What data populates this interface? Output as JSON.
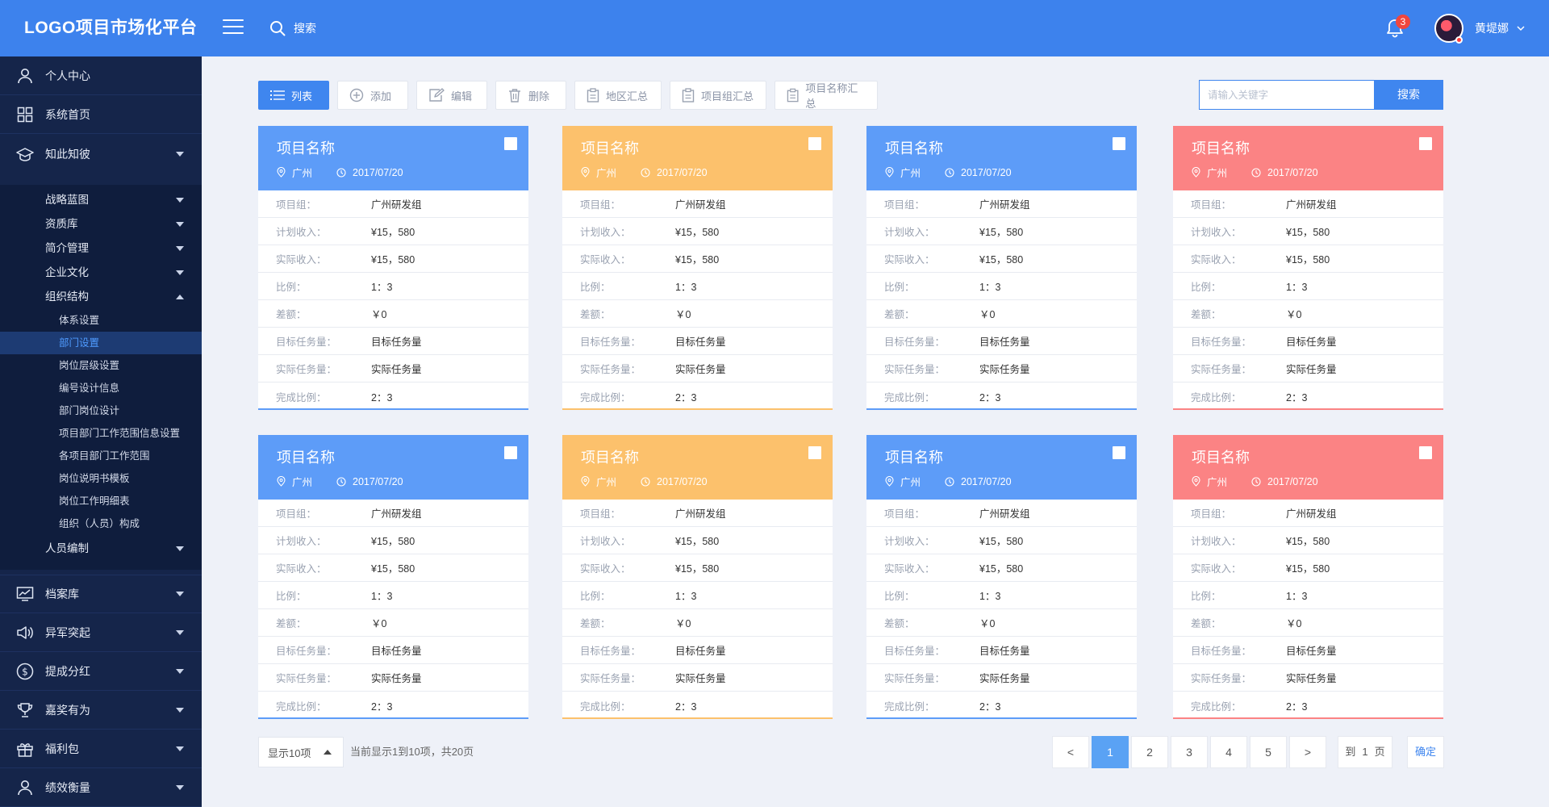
{
  "header": {
    "logo": "LOGO项目市场化平台",
    "search_label": "搜索",
    "notification_count": "3",
    "username": "黄堤娜",
    "bg_color": "#3d82ed"
  },
  "sidebar": {
    "top_items": [
      {
        "label": "个人中心",
        "icon": "user-icon"
      },
      {
        "label": "系统首页",
        "icon": "grid-icon"
      },
      {
        "label": "知此知彼",
        "icon": "graduation-cap-icon"
      }
    ],
    "sub_items": [
      "战略蓝图",
      "资质库",
      "简介管理",
      "企业文化",
      "组织结构"
    ],
    "sub3_items": [
      "体系设置",
      "部门设置",
      "岗位层级设置",
      "编号设计信息",
      "部门岗位设计",
      "项目部门工作范围信息设置",
      "各项目部门工作范围",
      "岗位说明书模板",
      "岗位工作明细表",
      "组织（人员）构成"
    ],
    "active_sub3": "部门设置",
    "extra_sub": "人员编制",
    "bottom_items": [
      {
        "label": "档案库",
        "icon": "chart-monitor-icon"
      },
      {
        "label": "异军突起",
        "icon": "speaker-icon"
      },
      {
        "label": "提成分红",
        "icon": "dollar-icon"
      },
      {
        "label": "嘉奖有为",
        "icon": "trophy-icon"
      },
      {
        "label": "福利包",
        "icon": "gift-icon"
      },
      {
        "label": "绩效衡量",
        "icon": "user-icon"
      }
    ]
  },
  "toolbar": {
    "buttons": [
      {
        "label": "列表",
        "icon": "list-icon"
      },
      {
        "label": "添加",
        "icon": "plus-circle-icon"
      },
      {
        "label": "编辑",
        "icon": "edit-icon"
      },
      {
        "label": "删除",
        "icon": "trash-icon"
      },
      {
        "label": "地区汇总",
        "icon": "clipboard-icon"
      },
      {
        "label": "项目组汇总",
        "icon": "clipboard-icon"
      },
      {
        "label": "项目名称汇总",
        "icon": "clipboard-icon"
      }
    ],
    "search_placeholder": "请输入关键字",
    "search_button": "搜索"
  },
  "cards": [
    {
      "title": "项目名称",
      "city": "广州",
      "date": "2017/07/20",
      "color": "#5d9cf8",
      "rows": [
        {
          "label": "项目组：",
          "value": "广州研发组"
        },
        {
          "label": "计划收入：",
          "value": "¥15，580"
        },
        {
          "label": "实际收入：",
          "value": "¥15，580"
        },
        {
          "label": "比例：",
          "value": "1：3"
        },
        {
          "label": "差额：",
          "value": "￥0"
        },
        {
          "label": "目标任务量：",
          "value": "目标任务量"
        },
        {
          "label": "实际任务量：",
          "value": "实际任务量"
        },
        {
          "label": "完成比例：",
          "value": "2：3"
        }
      ]
    },
    {
      "title": "项目名称",
      "city": "广州",
      "date": "2017/07/20",
      "color": "#fcc16c",
      "rows": [
        {
          "label": "项目组：",
          "value": "广州研发组"
        },
        {
          "label": "计划收入：",
          "value": "¥15，580"
        },
        {
          "label": "实际收入：",
          "value": "¥15，580"
        },
        {
          "label": "比例：",
          "value": "1：3"
        },
        {
          "label": "差额：",
          "value": "￥0"
        },
        {
          "label": "目标任务量：",
          "value": "目标任务量"
        },
        {
          "label": "实际任务量：",
          "value": "实际任务量"
        },
        {
          "label": "完成比例：",
          "value": "2：3"
        }
      ]
    },
    {
      "title": "项目名称",
      "city": "广州",
      "date": "2017/07/20",
      "color": "#5d9cf8",
      "rows": [
        {
          "label": "项目组：",
          "value": "广州研发组"
        },
        {
          "label": "计划收入：",
          "value": "¥15，580"
        },
        {
          "label": "实际收入：",
          "value": "¥15，580"
        },
        {
          "label": "比例：",
          "value": "1：3"
        },
        {
          "label": "差额：",
          "value": "￥0"
        },
        {
          "label": "目标任务量：",
          "value": "目标任务量"
        },
        {
          "label": "实际任务量：",
          "value": "实际任务量"
        },
        {
          "label": "完成比例：",
          "value": "2：3"
        }
      ]
    },
    {
      "title": "项目名称",
      "city": "广州",
      "date": "2017/07/20",
      "color": "#fb8384",
      "rows": [
        {
          "label": "项目组：",
          "value": "广州研发组"
        },
        {
          "label": "计划收入：",
          "value": "¥15，580"
        },
        {
          "label": "实际收入：",
          "value": "¥15，580"
        },
        {
          "label": "比例：",
          "value": "1：3"
        },
        {
          "label": "差额：",
          "value": "￥0"
        },
        {
          "label": "目标任务量：",
          "value": "目标任务量"
        },
        {
          "label": "实际任务量：",
          "value": "实际任务量"
        },
        {
          "label": "完成比例：",
          "value": "2：3"
        }
      ]
    },
    {
      "title": "项目名称",
      "city": "广州",
      "date": "2017/07/20",
      "color": "#5d9cf8",
      "rows": [
        {
          "label": "项目组：",
          "value": "广州研发组"
        },
        {
          "label": "计划收入：",
          "value": "¥15，580"
        },
        {
          "label": "实际收入：",
          "value": "¥15，580"
        },
        {
          "label": "比例：",
          "value": "1：3"
        },
        {
          "label": "差额：",
          "value": "￥0"
        },
        {
          "label": "目标任务量：",
          "value": "目标任务量"
        },
        {
          "label": "实际任务量：",
          "value": "实际任务量"
        },
        {
          "label": "完成比例：",
          "value": "2：3"
        }
      ]
    },
    {
      "title": "项目名称",
      "city": "广州",
      "date": "2017/07/20",
      "color": "#fcc16c",
      "rows": [
        {
          "label": "项目组：",
          "value": "广州研发组"
        },
        {
          "label": "计划收入：",
          "value": "¥15，580"
        },
        {
          "label": "实际收入：",
          "value": "¥15，580"
        },
        {
          "label": "比例：",
          "value": "1：3"
        },
        {
          "label": "差额：",
          "value": "￥0"
        },
        {
          "label": "目标任务量：",
          "value": "目标任务量"
        },
        {
          "label": "实际任务量：",
          "value": "实际任务量"
        },
        {
          "label": "完成比例：",
          "value": "2：3"
        }
      ]
    },
    {
      "title": "项目名称",
      "city": "广州",
      "date": "2017/07/20",
      "color": "#5d9cf8",
      "rows": [
        {
          "label": "项目组：",
          "value": "广州研发组"
        },
        {
          "label": "计划收入：",
          "value": "¥15，580"
        },
        {
          "label": "实际收入：",
          "value": "¥15，580"
        },
        {
          "label": "比例：",
          "value": "1：3"
        },
        {
          "label": "差额：",
          "value": "￥0"
        },
        {
          "label": "目标任务量：",
          "value": "目标任务量"
        },
        {
          "label": "实际任务量：",
          "value": "实际任务量"
        },
        {
          "label": "完成比例：",
          "value": "2：3"
        }
      ]
    },
    {
      "title": "项目名称",
      "city": "广州",
      "date": "2017/07/20",
      "color": "#fb8384",
      "rows": [
        {
          "label": "项目组：",
          "value": "广州研发组"
        },
        {
          "label": "计划收入：",
          "value": "¥15，580"
        },
        {
          "label": "实际收入：",
          "value": "¥15，580"
        },
        {
          "label": "比例：",
          "value": "1：3"
        },
        {
          "label": "差额：",
          "value": "￥0"
        },
        {
          "label": "目标任务量：",
          "value": "目标任务量"
        },
        {
          "label": "实际任务量：",
          "value": "实际任务量"
        },
        {
          "label": "完成比例：",
          "value": "2：3"
        }
      ]
    }
  ],
  "pagination": {
    "page_size_label": "显示10项",
    "info": "当前显示1到10项，共20页",
    "prev": "<",
    "next": ">",
    "pages": [
      "1",
      "2",
      "3",
      "4",
      "5"
    ],
    "current_page": "1",
    "goto_prefix": "到",
    "goto_value": "1",
    "goto_suffix": "页",
    "confirm_label": "确定"
  }
}
